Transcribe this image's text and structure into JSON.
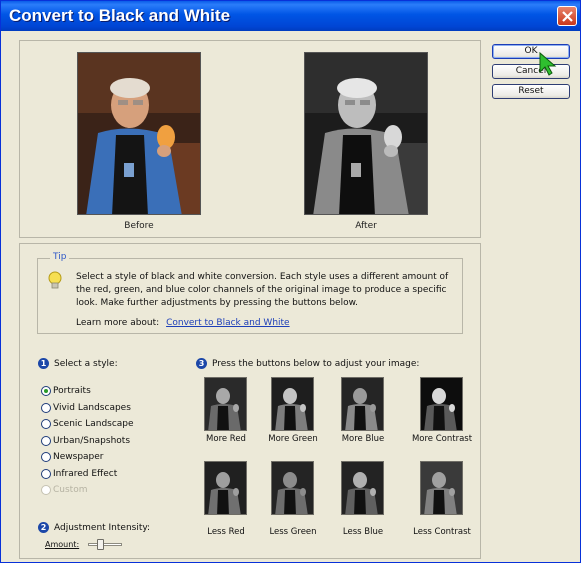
{
  "dialog": {
    "title": "Convert to Black and White",
    "close_icon": "close-x-icon"
  },
  "buttons": {
    "ok": "OK",
    "cancel": "Cancel",
    "reset": "Reset"
  },
  "preview": {
    "before_label": "Before",
    "after_label": "After"
  },
  "tip": {
    "legend": "Tip",
    "icon": "lightbulb-icon",
    "text": "Select a style of black and white conversion. Each style uses a different amount of the red, green, and blue color channels of the original image to produce a specific look. Make further adjustments by pressing the buttons below.",
    "learn_more_label": "Learn more about:",
    "learn_more_link": "Convert to Black and White"
  },
  "style_step": {
    "number": "1",
    "heading": "Select a style:",
    "selected": "Portraits",
    "options": [
      {
        "label": "Portraits",
        "checked": true,
        "disabled": false
      },
      {
        "label": "Vivid Landscapes",
        "checked": false,
        "disabled": false
      },
      {
        "label": "Scenic Landscape",
        "checked": false,
        "disabled": false
      },
      {
        "label": "Urban/Snapshots",
        "checked": false,
        "disabled": false
      },
      {
        "label": "Newspaper",
        "checked": false,
        "disabled": false
      },
      {
        "label": "Infrared Effect",
        "checked": false,
        "disabled": false
      },
      {
        "label": "Custom",
        "checked": false,
        "disabled": true
      }
    ]
  },
  "intensity_step": {
    "number": "2",
    "heading": "Adjustment Intensity:",
    "amount_label": "Amount:",
    "amount_fraction": 0.3
  },
  "adjust_step": {
    "number": "3",
    "heading": "Press the buttons below to adjust your image:",
    "buttons": [
      "More Red",
      "More Green",
      "More Blue",
      "More Contrast",
      "Less Red",
      "Less Green",
      "Less Blue",
      "Less Contrast"
    ]
  },
  "colors": {
    "title_bar": "#0055e5",
    "dialog_bg": "#ece9d8",
    "link": "#1d3fb8",
    "step_badge": "#1c47a8",
    "cursor": "#2fbf2f"
  }
}
